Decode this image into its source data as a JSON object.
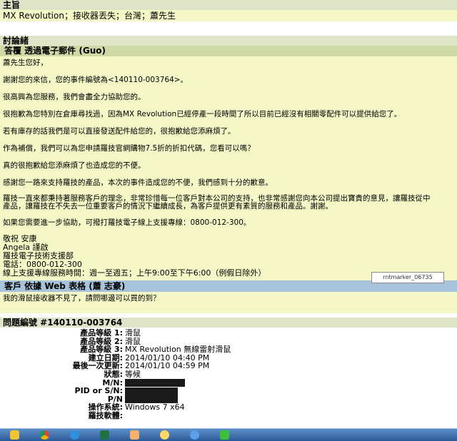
{
  "summary": {
    "title": "主旨",
    "value": "MX Revolution；接收器丟失；台灣；蕭先生"
  },
  "discussion": {
    "title": "討論緒",
    "reply_header": "答覆 透過電子郵件 (Guo)",
    "paragraphs": [
      "蕭先生您好，",
      "謝謝您的來信，您的事件編號為<140110-003764>。",
      "很高興為您服務，我們會盡全力協助您的。",
      "很抱歉為您特別在倉庫尋找過，因為MX Revolution已經停產一段時間了所以目前已經沒有相關零配件可以提供給您了。",
      "若有庫存的話我們是可以直接發送配件給您的，很抱歉給您添麻煩了。",
      "作為補償，我們可以為您申請羅技官網購物7.5折的折扣代碼，您看可以嗎？",
      "真的很抱歉給您添麻煩了也造成您的不便。",
      "感謝您一路來支持羅技的產品，本次的事件造成您的不便，我們感到十分的歉意。",
      "羅技一直來都秉持著服務客戶的理念，非常珍惜每一位客戶對本公司的支持，也非常感謝您向本公司提出寶貴的意見，讓羅技從中\n產品，讓羅技在不失去一位重要客戶的情況下繼續成長，為客戶提供更有素質的服務和產品。謝謝。",
      "如果您需要進一步協助，可撥打羅技電子線上支援專線：0800-012-300。"
    ],
    "signature": [
      "敬祝 安康",
      "Angela 謹啟",
      "羅技電子技術支援部",
      "電話：0800-012-300",
      "線上支援專線服務時間：週一至週五；上午9:00至下午6:00（例假日除外）"
    ],
    "customer_header": "客戶 依據 Web 表格 (蕭 志豪)",
    "customer_message": "我的滑鼠接收器不見了，請問哪邊可以買的到？",
    "marker_label": "rntmarker_06735"
  },
  "issue": {
    "title": "問題編號 #140110-003764",
    "fields": [
      {
        "label": "產品等級 1:",
        "value": "滑鼠"
      },
      {
        "label": "產品等級 2:",
        "value": "滑鼠"
      },
      {
        "label": "產品等級 3:",
        "value": "MX Revolution 無線雷射滑鼠"
      },
      {
        "label": "建立日期:",
        "value": "2014/01/10 04:40 PM"
      },
      {
        "label": "最後一次更新:",
        "value": "2014/01/10 04:59 PM"
      },
      {
        "label": "狀態:",
        "value": "等候"
      },
      {
        "label": "M/N:",
        "value": ""
      },
      {
        "label": "PID or S/N:",
        "value": ""
      },
      {
        "label": "P/N",
        "value": ""
      },
      {
        "label": "操作系統:",
        "value": "Windows 7 x64"
      },
      {
        "label": "羅技軟體:",
        "value": ""
      }
    ]
  },
  "taskbar": {
    "icons": [
      "folder-icon",
      "chrome-icon",
      "ie-icon",
      "excel-icon",
      "photoshop-icon",
      "weather-icon",
      "globe-icon",
      "line-icon"
    ]
  }
}
